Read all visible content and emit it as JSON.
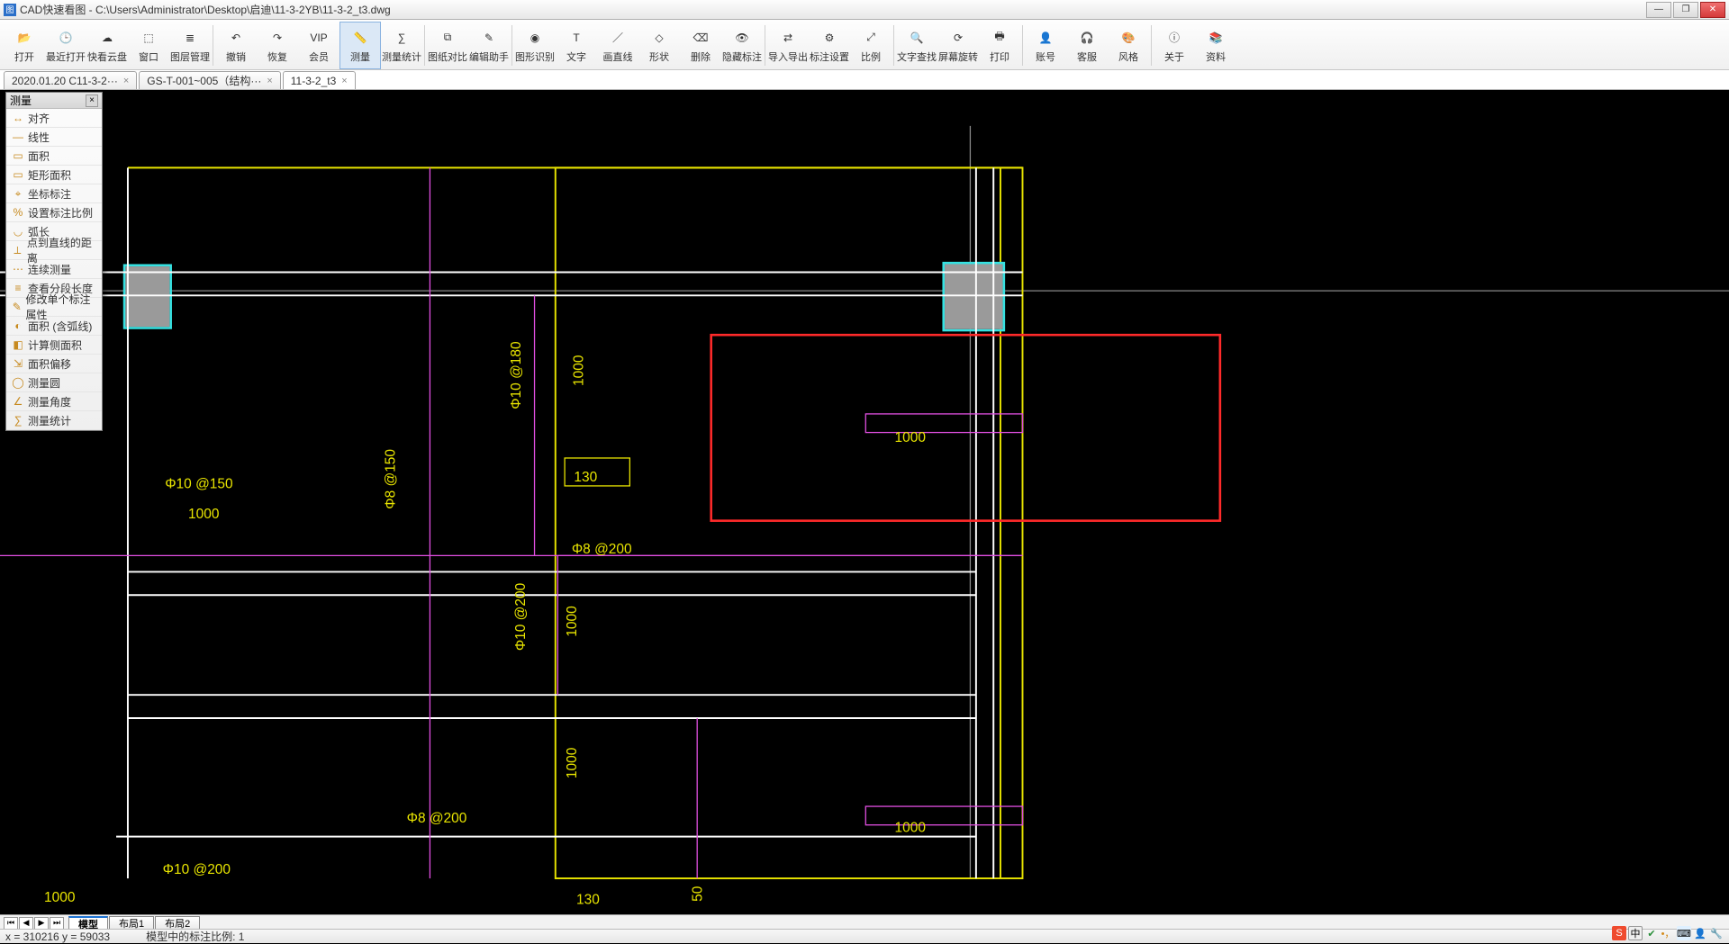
{
  "window": {
    "title": "CAD快速看图 - C:\\Users\\Administrator\\Desktop\\启迪\\11-3-2YB\\11-3-2_t3.dwg"
  },
  "toolbar": [
    {
      "id": "open",
      "label": "打开"
    },
    {
      "id": "recent",
      "label": "最近打开"
    },
    {
      "id": "cloud",
      "label": "快看云盘"
    },
    {
      "id": "window",
      "label": "窗口"
    },
    {
      "id": "layer",
      "label": "图层管理"
    },
    {
      "id": "sep"
    },
    {
      "id": "undo",
      "label": "撤销"
    },
    {
      "id": "redo",
      "label": "恢复"
    },
    {
      "id": "vip",
      "label": "会员"
    },
    {
      "id": "measure",
      "label": "测量",
      "active": true
    },
    {
      "id": "mstats",
      "label": "测量统计"
    },
    {
      "id": "sep"
    },
    {
      "id": "compare",
      "label": "图纸对比"
    },
    {
      "id": "edit",
      "label": "编辑助手"
    },
    {
      "id": "sep"
    },
    {
      "id": "recog",
      "label": "图形识别"
    },
    {
      "id": "text",
      "label": "文字"
    },
    {
      "id": "line",
      "label": "画直线"
    },
    {
      "id": "shape",
      "label": "形状"
    },
    {
      "id": "delete",
      "label": "删除"
    },
    {
      "id": "hide",
      "label": "隐藏标注"
    },
    {
      "id": "sep"
    },
    {
      "id": "export",
      "label": "导入导出"
    },
    {
      "id": "dimset",
      "label": "标注设置"
    },
    {
      "id": "scale",
      "label": "比例"
    },
    {
      "id": "sep"
    },
    {
      "id": "search",
      "label": "文字查找"
    },
    {
      "id": "rotate",
      "label": "屏幕旋转"
    },
    {
      "id": "print",
      "label": "打印"
    },
    {
      "id": "sep"
    },
    {
      "id": "account",
      "label": "账号"
    },
    {
      "id": "service",
      "label": "客服"
    },
    {
      "id": "style",
      "label": "风格"
    },
    {
      "id": "sep"
    },
    {
      "id": "about",
      "label": "关于"
    },
    {
      "id": "data",
      "label": "资料"
    }
  ],
  "tabs": [
    {
      "label": "2020.01.20 C11-3-2···",
      "active": false
    },
    {
      "label": "GS-T-001~005（结构···",
      "active": false
    },
    {
      "label": "11-3-2_t3",
      "active": true
    }
  ],
  "measure_panel": {
    "title": "测量",
    "items": [
      "对齐",
      "线性",
      "面积",
      "矩形面积",
      "坐标标注",
      "设置标注比例",
      "弧长",
      "点到直线的距离",
      "连续测量",
      "查看分段长度",
      "修改单个标注属性",
      "面积 (含弧线)",
      "计算侧面积",
      "面积偏移",
      "测量圆",
      "测量角度",
      "测量统计"
    ]
  },
  "drawing_labels": {
    "a": "Φ10 @150",
    "b": "1000",
    "c": "Φ8 @150",
    "d": "Φ10 @180",
    "e": "1000",
    "f": "130",
    "g": "Φ8 @200",
    "h": "Φ10 @200",
    "i": "1000",
    "j": "1000",
    "k": "Φ8 @200",
    "l": "Φ10 @200",
    "m": "1000",
    "n": "1000",
    "o": "1000",
    "p": "130",
    "q": "50"
  },
  "layout_tabs": {
    "items": [
      "模型",
      "布局1",
      "布局2"
    ],
    "active": 0
  },
  "status": {
    "coords": "x = 310216  y = 59033",
    "scale": "模型中的标注比例: 1"
  },
  "tray": {
    "ime": "中"
  }
}
